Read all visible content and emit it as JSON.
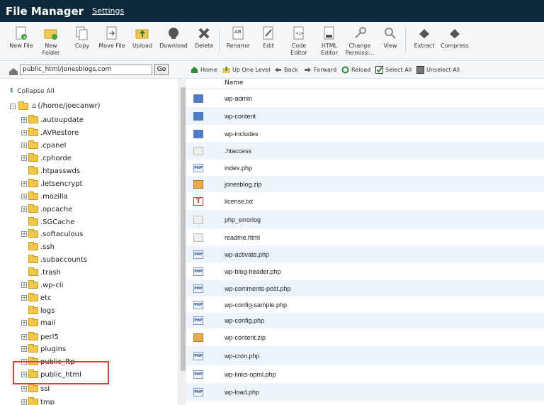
{
  "header": {
    "title": "File Manager",
    "settings_link": "Settings"
  },
  "toolbar": {
    "items": [
      {
        "label": "New File"
      },
      {
        "label": "New\nFolder"
      },
      {
        "label": "Copy"
      },
      {
        "label": "Move File"
      },
      {
        "label": "Upload"
      },
      {
        "label": "Download"
      },
      {
        "label": "Delete"
      },
      {
        "label": "Rename"
      },
      {
        "label": "Edit"
      },
      {
        "label": "Code\nEditor"
      },
      {
        "label": "HTML\nEditor"
      },
      {
        "label": "Change\nPermissi..."
      },
      {
        "label": "View"
      },
      {
        "label": "Extract"
      },
      {
        "label": "Compress"
      }
    ]
  },
  "path": {
    "value": "public_html/jonesblogs.com",
    "go_label": "Go"
  },
  "nav": {
    "home": "Home",
    "up": "Up One Level",
    "back": "Back",
    "forward": "Forward",
    "reload": "Reload",
    "select_all": "Select All",
    "unselect_all": "Unselect All"
  },
  "tree": {
    "collapse_label": "Collapse All",
    "root_label": "(/home/joecanwr)",
    "items": [
      {
        "label": ".autoupdate",
        "expandable": true
      },
      {
        "label": ".AVRestore",
        "expandable": true
      },
      {
        "label": ".cpanel",
        "expandable": true
      },
      {
        "label": ".cphorde",
        "expandable": true
      },
      {
        "label": ".htpasswds",
        "expandable": false
      },
      {
        "label": ".letsencrypt",
        "expandable": true
      },
      {
        "label": ".mozilla",
        "expandable": true
      },
      {
        "label": ".opcache",
        "expandable": true
      },
      {
        "label": ".SGCache",
        "expandable": false
      },
      {
        "label": ".softaculous",
        "expandable": true
      },
      {
        "label": ".ssh",
        "expandable": false
      },
      {
        "label": ".subaccounts",
        "expandable": false
      },
      {
        "label": ".trash",
        "expandable": false
      },
      {
        "label": ".wp-cli",
        "expandable": true
      },
      {
        "label": "etc",
        "expandable": true
      },
      {
        "label": "logs",
        "expandable": false
      },
      {
        "label": "mail",
        "expandable": true
      },
      {
        "label": "perl5",
        "expandable": true
      },
      {
        "label": "plugins",
        "expandable": true
      },
      {
        "label": "public_ftp",
        "expandable": true
      },
      {
        "label": "public_html",
        "expandable": true
      },
      {
        "label": "ssl",
        "expandable": true
      },
      {
        "label": "tmp",
        "expandable": true
      }
    ]
  },
  "table": {
    "header_name": "Name",
    "rows": [
      {
        "name": "wp-admin",
        "icon": "folder-icon"
      },
      {
        "name": "wp-content",
        "icon": "folder-icon"
      },
      {
        "name": "wp-includes",
        "icon": "folder-icon"
      },
      {
        "name": ".htaccess",
        "icon": "text-file-icon"
      },
      {
        "name": "index.php",
        "icon": "php-file-icon"
      },
      {
        "name": "jonesblog.zip",
        "icon": "zip-file-icon"
      },
      {
        "name": "license.txt",
        "icon": "txt-file-icon"
      },
      {
        "name": "php_errorlog",
        "icon": "text-file-icon"
      },
      {
        "name": "readme.html",
        "icon": "text-file-icon"
      },
      {
        "name": "wp-activate.php",
        "icon": "php-file-icon"
      },
      {
        "name": "wp-blog-header.php",
        "icon": "php-file-icon"
      },
      {
        "name": "wp-comments-post.php",
        "icon": "php-file-icon"
      },
      {
        "name": "wp-config-sample.php",
        "icon": "php-file-icon"
      },
      {
        "name": "wp-config.php",
        "icon": "php-file-icon"
      },
      {
        "name": "wp-content.zip",
        "icon": "zip-file-icon"
      },
      {
        "name": "wp-cron.php",
        "icon": "php-file-icon"
      },
      {
        "name": "wp-links-opml.php",
        "icon": "php-file-icon"
      },
      {
        "name": "wp-load.php",
        "icon": "php-file-icon"
      }
    ]
  },
  "colors": {
    "header_bg": "#0c2a3c",
    "row_alt": "#eef4fb",
    "highlight": "#e53935"
  }
}
